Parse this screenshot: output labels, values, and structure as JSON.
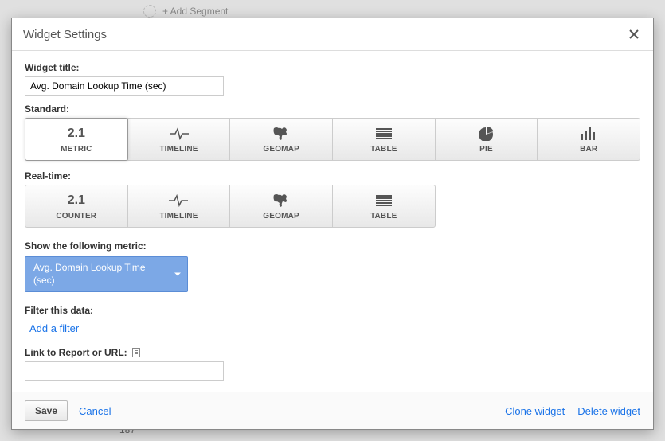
{
  "background": {
    "add_segment": "+ Add Segment",
    "val": "187"
  },
  "modal": {
    "title": "Widget Settings"
  },
  "widget_title": {
    "label": "Widget title:",
    "value": "Avg. Domain Lookup Time (sec)"
  },
  "standard": {
    "label": "Standard:",
    "items": [
      {
        "icon_label": "2.1",
        "caption": "METRIC",
        "selected": true
      },
      {
        "caption": "TIMELINE"
      },
      {
        "caption": "GEOMAP"
      },
      {
        "caption": "TABLE"
      },
      {
        "caption": "PIE"
      },
      {
        "caption": "BAR"
      }
    ]
  },
  "realtime": {
    "label": "Real-time:",
    "items": [
      {
        "icon_label": "2.1",
        "caption": "COUNTER"
      },
      {
        "caption": "TIMELINE"
      },
      {
        "caption": "GEOMAP"
      },
      {
        "caption": "TABLE"
      }
    ]
  },
  "metric": {
    "label": "Show the following metric:",
    "selected": "Avg. Domain Lookup Time (sec)"
  },
  "filter": {
    "label": "Filter this data:",
    "add": "Add a filter"
  },
  "link_report": {
    "label": "Link to Report or URL:",
    "value": ""
  },
  "footer": {
    "save": "Save",
    "cancel": "Cancel",
    "clone": "Clone widget",
    "delete": "Delete widget"
  }
}
